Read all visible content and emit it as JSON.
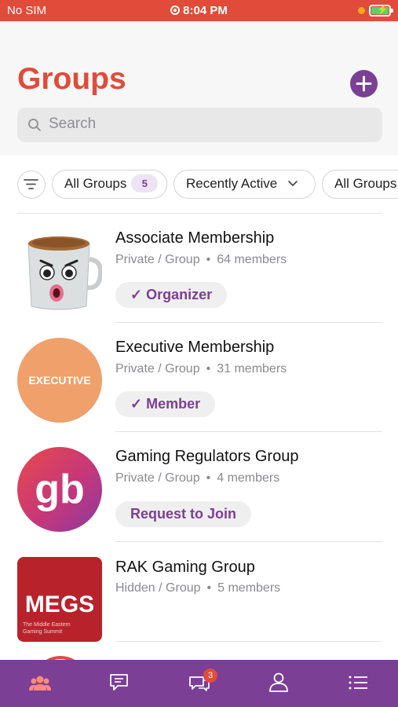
{
  "status_bar": {
    "carrier": "No SIM",
    "time": "8:04 PM"
  },
  "header": {
    "title": "Groups"
  },
  "search": {
    "placeholder": "Search"
  },
  "filters": {
    "all_groups_label": "All Groups",
    "all_groups_count": "5",
    "sort_label": "Recently Active",
    "type_label": "All Groups"
  },
  "groups": [
    {
      "name": "Associate Membership",
      "privacy": "Private / Group",
      "members": "64 members",
      "role": "✓ Organizer"
    },
    {
      "name": "Executive Membership",
      "privacy": "Private / Group",
      "members": "31 members",
      "role": "✓ Member",
      "avatar_text": "EXECUTIVE"
    },
    {
      "name": "Gaming Regulators Group",
      "privacy": "Private / Group",
      "members": "4 members",
      "role": "Request to Join",
      "avatar_text": "gb"
    },
    {
      "name": "RAK Gaming Group",
      "privacy": "Hidden / Group",
      "members": "5 members",
      "avatar_text": "MEGS",
      "avatar_subtext_1": "The Middle Eastern",
      "avatar_subtext_2": "Gaming Summit"
    }
  ],
  "tab_bar": {
    "messages_badge": "3"
  },
  "colors": {
    "accent": "#e14b3a",
    "brand": "#7b3f96",
    "tab_active": "#ff8a7a"
  }
}
